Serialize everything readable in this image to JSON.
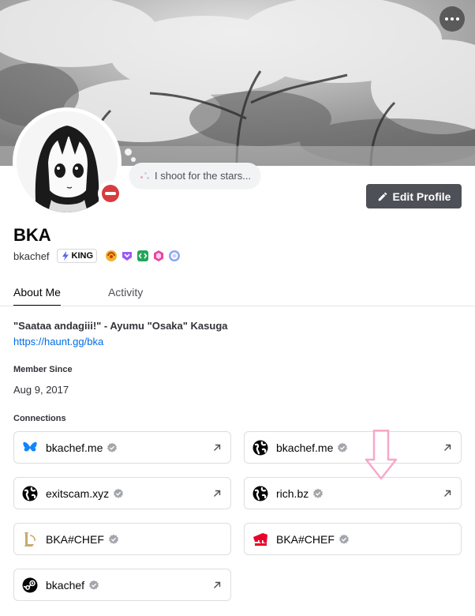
{
  "profile": {
    "display_name": "BKA",
    "username": "bkachef",
    "custom_status": "I shoot for the stars...",
    "edit_button": "Edit Profile",
    "guild_tag": "KING",
    "badges": [
      "nitro-boost-badge",
      "hypesquad-badge",
      "dev-badge",
      "quest-badge",
      "orbs-badge"
    ]
  },
  "tabs": [
    {
      "label": "About Me",
      "active": true
    },
    {
      "label": "Activity",
      "active": false
    }
  ],
  "about": {
    "bio": "\"Saataa andagiii!\" - Ayumu \"Osaka\" Kasuga",
    "link": "https://haunt.gg/bka",
    "member_since_label": "Member Since",
    "member_since": "Aug 9, 2017",
    "connections_label": "Connections"
  },
  "connections": [
    {
      "name": "bkachef.me",
      "icon": "bluesky-icon",
      "external": true
    },
    {
      "name": "bkachef.me",
      "icon": "globe-icon",
      "external": true
    },
    {
      "name": "exitscam.xyz",
      "icon": "globe-icon",
      "external": true
    },
    {
      "name": "rich.bz",
      "icon": "globe-icon",
      "external": true
    },
    {
      "name": "BKA#CHEF",
      "icon": "league-icon",
      "external": false
    },
    {
      "name": "BKA#CHEF",
      "icon": "riot-icon",
      "external": false
    },
    {
      "name": "bkachef",
      "icon": "steam-icon",
      "external": true
    }
  ],
  "colors": {
    "edit_button_bg": "#4e5058",
    "status_dnd": "#d83c3e",
    "link": "#006ce7",
    "annotation_arrow": "#f7a8c8"
  }
}
